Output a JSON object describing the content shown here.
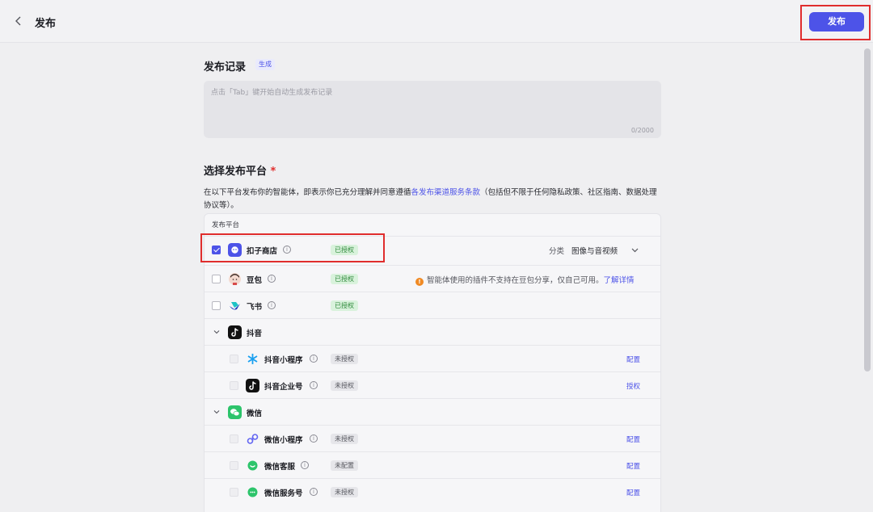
{
  "header": {
    "title": "发布",
    "publish_label": "发布"
  },
  "record": {
    "title": "发布记录",
    "generate_label": "生成",
    "placeholder": "点击「Tab」键开始自动生成发布记录",
    "count": "0/2000"
  },
  "platform": {
    "title": "选择发布平台",
    "required_mark": "*",
    "desc_before": "在以下平台发布你的智能体，即表示你已充分理解并同意遵循",
    "desc_link": "各发布渠道服务条款",
    "desc_after": "（包括但不限于任何隐私政策、社区指南、数据处理协议等）。",
    "column_header": "发布平台",
    "rows": [
      {
        "name": "扣子商店",
        "info": "i",
        "status": "已授权",
        "category_label": "分类",
        "category_value": "图像与音视频"
      },
      {
        "name": "豆包",
        "info": "i",
        "status": "已授权",
        "warning": "智能体使用的插件不支持在豆包分享，仅自己可用。",
        "warning_link": "了解详情",
        "warn_glyph": "!"
      },
      {
        "name": "飞书",
        "info": "i",
        "status": "已授权"
      },
      {
        "name": "抖音"
      },
      {
        "name": "抖音小程序",
        "info": "i",
        "status": "未授权",
        "action": "配置"
      },
      {
        "name": "抖音企业号",
        "info": "i",
        "status": "未授权",
        "action": "授权"
      },
      {
        "name": "微信"
      },
      {
        "name": "微信小程序",
        "info": "i",
        "status": "未授权",
        "action": "配置"
      },
      {
        "name": "微信客服",
        "info": "i",
        "status": "未配置",
        "action": "配置"
      },
      {
        "name": "微信服务号",
        "info": "i",
        "status": "未授权",
        "action": "配置"
      }
    ]
  },
  "colors": {
    "accent": "#4d53e8",
    "highlight": "#e02d2d",
    "authorized": "#2f8a3b",
    "warning": "#f08a24"
  }
}
